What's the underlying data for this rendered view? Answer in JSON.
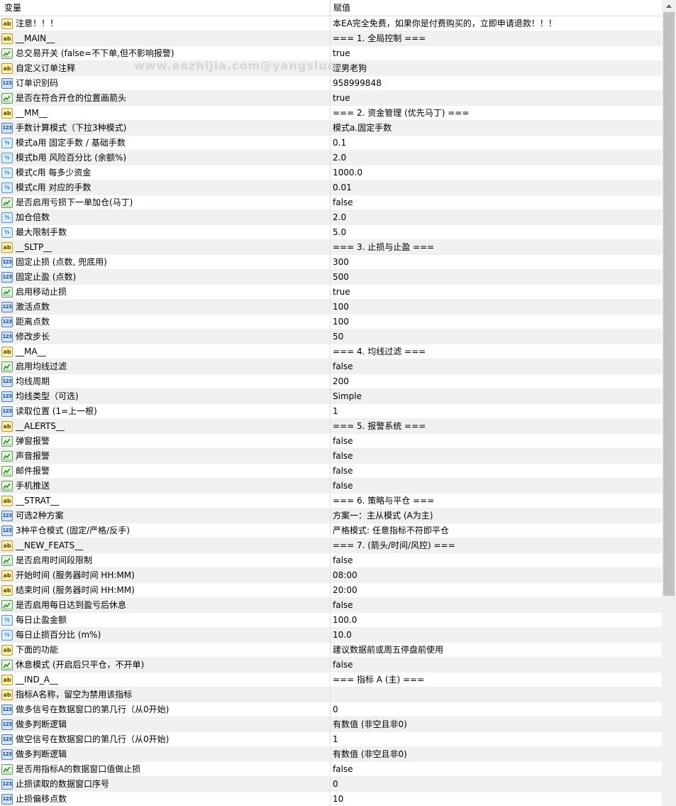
{
  "header": {
    "col1": "变量",
    "col2": "赋值"
  },
  "watermark": "www.eazhijia.com@yangsluo",
  "rows": [
    {
      "icon": "ab",
      "name": "注意！！！",
      "value": "本EA完全免费，如果你是付费购买的，立即申请退款！！！"
    },
    {
      "icon": "ab",
      "name": "__MAIN__",
      "value": "=== 1. 全局控制 ==="
    },
    {
      "icon": "bool",
      "name": "总交易开关 (false=不下单,但不影响报警)",
      "value": "true"
    },
    {
      "icon": "ab",
      "name": "自定义订单注释",
      "value": "涩男老狗"
    },
    {
      "icon": "123",
      "name": "订单识别码",
      "value": "958999848"
    },
    {
      "icon": "bool",
      "name": "是否在符合开仓的位置画箭头",
      "value": "true"
    },
    {
      "icon": "ab",
      "name": "__MM__",
      "value": "=== 2. 资金管理 (优先马丁) ==="
    },
    {
      "icon": "123",
      "name": "手数计算模式（下拉3种模式)",
      "value": "模式a.固定手数"
    },
    {
      "icon": "half",
      "name": "模式a用 固定手数 / 基础手数",
      "value": "0.1"
    },
    {
      "icon": "half",
      "name": "模式b用 风险百分比 (余额%)",
      "value": "2.0"
    },
    {
      "icon": "half",
      "name": "模式c用 每多少资金",
      "value": "1000.0"
    },
    {
      "icon": "half",
      "name": "模式c用 对应的手数",
      "value": "0.01"
    },
    {
      "icon": "bool",
      "name": "是否启用亏损下一单加仓(马丁)",
      "value": "false"
    },
    {
      "icon": "half",
      "name": "加仓倍数",
      "value": "2.0"
    },
    {
      "icon": "half",
      "name": "最大限制手数",
      "value": "5.0"
    },
    {
      "icon": "ab",
      "name": "__SLTP__",
      "value": "=== 3. 止损与止盈 ==="
    },
    {
      "icon": "123",
      "name": "固定止损 (点数, 兜底用)",
      "value": "300"
    },
    {
      "icon": "123",
      "name": "固定止盈 (点数)",
      "value": "500"
    },
    {
      "icon": "bool",
      "name": "启用移动止损",
      "value": "true"
    },
    {
      "icon": "123",
      "name": "激活点数",
      "value": "100"
    },
    {
      "icon": "123",
      "name": "距离点数",
      "value": "100"
    },
    {
      "icon": "123",
      "name": "修改步长",
      "value": "50"
    },
    {
      "icon": "ab",
      "name": "__MA__",
      "value": "=== 4. 均线过滤 ==="
    },
    {
      "icon": "bool",
      "name": "启用均线过滤",
      "value": "false"
    },
    {
      "icon": "123",
      "name": "均线周期",
      "value": "200"
    },
    {
      "icon": "123",
      "name": "均线类型（可选)",
      "value": "Simple"
    },
    {
      "icon": "123",
      "name": "读取位置 (1=上一根)",
      "value": "1"
    },
    {
      "icon": "ab",
      "name": "__ALERTS__",
      "value": "=== 5. 报警系统 ==="
    },
    {
      "icon": "bool",
      "name": "弹窗报警",
      "value": "false"
    },
    {
      "icon": "bool",
      "name": "声音报警",
      "value": "false"
    },
    {
      "icon": "bool",
      "name": "邮件报警",
      "value": "false"
    },
    {
      "icon": "bool",
      "name": "手机推送",
      "value": "false"
    },
    {
      "icon": "ab",
      "name": "__STRAT__",
      "value": "=== 6. 策略与平仓 ==="
    },
    {
      "icon": "123",
      "name": "可选2种方案",
      "value": "方案一：主从模式 (A为主)"
    },
    {
      "icon": "123",
      "name": "3种平仓模式 (固定/严格/反手)",
      "value": "严格模式: 任意指标不符即平仓"
    },
    {
      "icon": "ab",
      "name": "__NEW_FEATS__",
      "value": "=== 7. (箭头/时间/风控) ==="
    },
    {
      "icon": "bool",
      "name": "是否启用时间段限制",
      "value": "false"
    },
    {
      "icon": "ab",
      "name": "开始时间 (服务器时间 HH:MM)",
      "value": "08:00"
    },
    {
      "icon": "ab",
      "name": "结束时间 (服务器时间 HH:MM)",
      "value": "20:00"
    },
    {
      "icon": "bool",
      "name": "是否启用每日达到盈亏后休息",
      "value": "false"
    },
    {
      "icon": "half",
      "name": "每日止盈金额",
      "value": "100.0"
    },
    {
      "icon": "half",
      "name": "每日止损百分比 (m%)",
      "value": "10.0"
    },
    {
      "icon": "ab",
      "name": "下面的功能",
      "value": "建议数据前或周五停盘前使用"
    },
    {
      "icon": "bool",
      "name": "休息模式 (开启后只平仓，不开单)",
      "value": "false"
    },
    {
      "icon": "ab",
      "name": "__IND_A__",
      "value": "=== 指标 A (主) ==="
    },
    {
      "icon": "ab",
      "name": "指标A名称，留空为禁用该指标",
      "value": ""
    },
    {
      "icon": "123",
      "name": "做多信号在数据窗口的第几行（从0开始)",
      "value": "0"
    },
    {
      "icon": "123",
      "name": "做多判断逻辑",
      "value": "有数值 (非空且非0)"
    },
    {
      "icon": "123",
      "name": "做空信号在数据窗口的第几行（从0开始)",
      "value": "1"
    },
    {
      "icon": "123",
      "name": "做多判断逻辑",
      "value": "有数值 (非空且非0)"
    },
    {
      "icon": "bool",
      "name": "是否用指标A的数据窗口值做止损",
      "value": "false"
    },
    {
      "icon": "123",
      "name": "止损读取的数据窗口序号",
      "value": "0"
    },
    {
      "icon": "123",
      "name": "止损偏移点数",
      "value": "10"
    }
  ]
}
